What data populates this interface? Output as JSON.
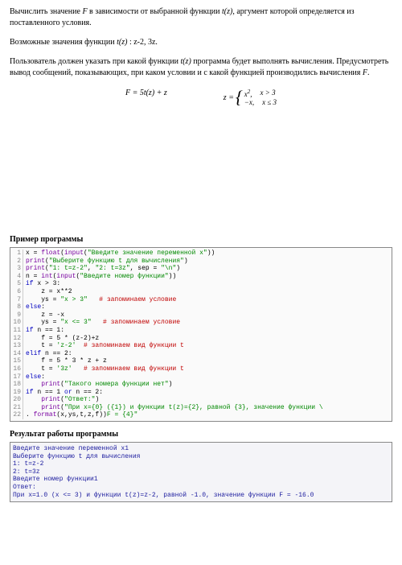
{
  "problem": {
    "p1_a": "Вычислить значение ",
    "p1_b": " в зависимости от выбранной функции  ",
    "p1_c": ", аргумент  которой определяется из поставленного условия.",
    "p2_a": "Возможные значения функции ",
    "p2_b": " : z-2, 3z.",
    "p3_a": "Пользователь должен указать   при какой функции ",
    "p3_b": "   программа будет выполнять вычисления. Предусмотреть вывод сообщений, показывающих, при каком условии и с какой функцией производились вычисления ",
    "p3_c": ".",
    "F": "F",
    "tz": "t(z)",
    "formula_lhs": "F = 5t(z) + z",
    "formula_z_lhs": "z = ",
    "case1_expr": "x",
    "case1_sup": "2",
    "case1_sep": ",",
    "case1_cond": "x > 3",
    "case2_expr": "−x,",
    "case2_cond": "x ≤ 3"
  },
  "titles": {
    "program_example": "Пример программы",
    "program_output": "Результат работы программы"
  },
  "code": [
    {
      "n": "1",
      "t": "x = ",
      "f": "float",
      "p": "(",
      "f2": "input",
      "p2": "(",
      "s": "\"Введите значение переменной x\"",
      "e": "))"
    },
    {
      "n": "2",
      "f": "print",
      "p": "(",
      "s": "\"Выберите функцию t для вычисления\"",
      "e": ")"
    },
    {
      "n": "3",
      "f": "print",
      "p": "(",
      "s": "\"1: t=z-2\"",
      "c": ", ",
      "s2": "\"2: t=3z\"",
      "c2": ", sep = ",
      "s3": "\"\\n\"",
      "e": ")"
    },
    {
      "n": "4",
      "t": "n = ",
      "f": "int",
      "p": "(",
      "f2": "input",
      "p2": "(",
      "s": "\"Введите номер функции\"",
      "e": "))"
    },
    {
      "n": "5",
      "k": "if",
      "t": " x > 3:"
    },
    {
      "n": "6",
      "t": "    z = x**2"
    },
    {
      "n": "7",
      "t": "    ys = ",
      "s": "\"x > 3\"",
      "cm": "   # запоминаем условие"
    },
    {
      "n": "8",
      "k": "else",
      "t": ":"
    },
    {
      "n": "9",
      "t": "    z = -x"
    },
    {
      "n": "10",
      "t": "    ys = ",
      "s": "\"x <= 3\"",
      "cm": "   # запоминаем условие"
    },
    {
      "n": "11",
      "k": "if",
      "t": " n == 1:"
    },
    {
      "n": "12",
      "t": "    f = 5 * (z-2)+z"
    },
    {
      "n": "13",
      "t": "    t = ",
      "s": "'z-2'",
      "cm": "  # запоминаем вид функции t"
    },
    {
      "n": "14",
      "k": "elif",
      "t": " n == 2:"
    },
    {
      "n": "15",
      "t": "    f = 5 * 3 * z + z"
    },
    {
      "n": "16",
      "t": "    t = ",
      "s": "'3z'",
      "cm": "   # запоминаем вид функции t"
    },
    {
      "n": "17",
      "k": "else",
      "t": ":"
    },
    {
      "n": "18",
      "t": "    ",
      "f": "print",
      "p": "(",
      "s": "\"Такого номера функции нет\"",
      "e": ")"
    },
    {
      "n": "19",
      "k": "if",
      "t": " n == 1 ",
      "k2": "or",
      "t2": " n == 2:"
    },
    {
      "n": "20",
      "t": "    ",
      "f": "print",
      "p": "(",
      "s": "\"Ответ:\"",
      "e": ")"
    },
    {
      "n": "21",
      "t": "    ",
      "f": "print",
      "p": "(",
      "s": "\"При x={0} ({1}) и функции t(z)={2}, равной {3}, значение функции \\"
    },
    {
      "n": "22",
      "s": "F = {4}\"",
      "t": ". ",
      "f": "format",
      "p2": "(x,ys,t,z,f))"
    }
  ],
  "output": [
    "Введите значение переменной x1",
    "Выберите функцию t для вычисления",
    "1: t=z-2",
    "2: t=3z",
    "Введите номер функции1",
    "Ответ:",
    "При x=1.0 (x <= 3) и функции t(z)=z-2, равной -1.0, значение функции F = -16.0"
  ]
}
